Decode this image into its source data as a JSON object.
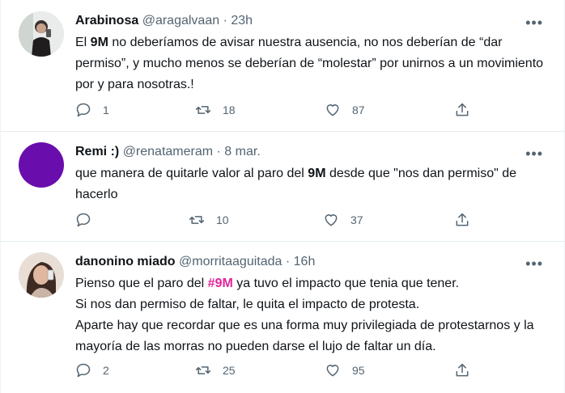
{
  "tweets": [
    {
      "name": "Arabinosa",
      "handle": "@aragalvaan",
      "time": "· 23h",
      "text": {
        "p1": "El ",
        "b1": "9M",
        "p2": " no deberíamos de avisar nuestra ausencia, no nos deberían de “dar permiso”, y mucho menos se deberían de “molestar” por unirnos a un movimiento por y para nosotras.!"
      },
      "replies": "1",
      "retweets": "18",
      "likes": "87",
      "avatar_color": "#9aa6a0"
    },
    {
      "name": "Remi :)",
      "handle": "@renatameram",
      "time": "· 8 mar.",
      "text": {
        "p1": "que manera de quitarle valor al paro del ",
        "b1": "9M",
        "p2": " desde que \"nos dan permiso\" de hacerlo"
      },
      "replies": "",
      "retweets": "10",
      "likes": "37",
      "avatar_color": "#6a0dad"
    },
    {
      "name": "danonino miado",
      "handle": "@morritaaguitada",
      "time": "· 16h",
      "text": {
        "p1": "Pienso que el paro del ",
        "hashtag": "#9M",
        "p2": " ya tuvo el impacto que tenia que tener.",
        "line2": "Si nos dan permiso de faltar, le quita el impacto de protesta.",
        "line3": "Aparte hay que recordar que es una forma muy privilegiada de protestarnos y la mayoría de las morras no pueden darse el lujo de faltar un día."
      },
      "replies": "2",
      "retweets": "25",
      "likes": "95",
      "avatar_color": "#c9a89a"
    }
  ],
  "more_label": "•••",
  "colors": {
    "hashtag": "#e0249c",
    "muted": "#536471",
    "text": "#0f1419"
  }
}
